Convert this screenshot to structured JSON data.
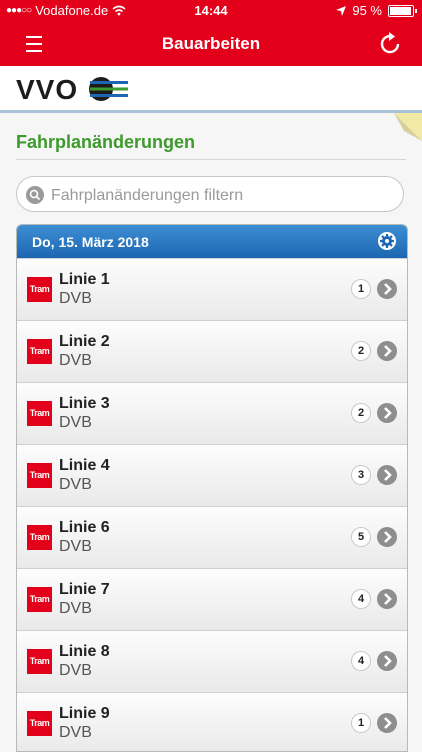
{
  "status": {
    "carrier": "Vodafone.de",
    "time": "14:44",
    "battery": "95 %",
    "battery_level": 0.95
  },
  "nav": {
    "title": "Bauarbeiten"
  },
  "logo": {
    "text": "VVO"
  },
  "page": {
    "heading": "Fahrplanänderungen",
    "search_placeholder": "Fahrplanänderungen filtern"
  },
  "list": {
    "date": "Do, 15. März 2018",
    "rows": [
      {
        "badge": "Tram",
        "name": "Linie 1",
        "operator": "DVB",
        "count": "1"
      },
      {
        "badge": "Tram",
        "name": "Linie 2",
        "operator": "DVB",
        "count": "2"
      },
      {
        "badge": "Tram",
        "name": "Linie 3",
        "operator": "DVB",
        "count": "2"
      },
      {
        "badge": "Tram",
        "name": "Linie 4",
        "operator": "DVB",
        "count": "3"
      },
      {
        "badge": "Tram",
        "name": "Linie 6",
        "operator": "DVB",
        "count": "5"
      },
      {
        "badge": "Tram",
        "name": "Linie 7",
        "operator": "DVB",
        "count": "4"
      },
      {
        "badge": "Tram",
        "name": "Linie 8",
        "operator": "DVB",
        "count": "4"
      },
      {
        "badge": "Tram",
        "name": "Linie 9",
        "operator": "DVB",
        "count": "1"
      }
    ]
  },
  "colors": {
    "brand_red": "#e2001a",
    "heading_green": "#3d9a2c",
    "header_blue": "#1d66b1"
  }
}
